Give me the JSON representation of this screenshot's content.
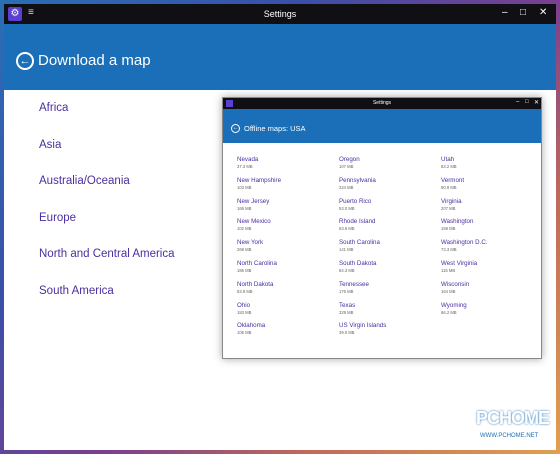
{
  "window": {
    "title": "Settings",
    "menu_icon": "hamburger-icon",
    "app_icon": "gear-icon",
    "controls": [
      "–",
      "□",
      "✕"
    ]
  },
  "header": {
    "title": "Download a map",
    "back_icon": "back-arrow-icon"
  },
  "regions": [
    "Africa",
    "Asia",
    "Australia/Oceania",
    "Europe",
    "North and Central America",
    "South America"
  ],
  "inner_window": {
    "title": "Settings",
    "header_title": "Offline maps: USA",
    "states": [
      {
        "name": "Nevada",
        "size": "37.3 MB"
      },
      {
        "name": "New Hampshire",
        "size": "103 MB"
      },
      {
        "name": "New Jersey",
        "size": "166 MB"
      },
      {
        "name": "New Mexico",
        "size": "102 MB"
      },
      {
        "name": "New York",
        "size": "268 MB"
      },
      {
        "name": "North Carolina",
        "size": "186 MB"
      },
      {
        "name": "North Dakota",
        "size": "83.9 MB"
      },
      {
        "name": "Ohio",
        "size": "183 MB"
      },
      {
        "name": "Oklahoma",
        "size": "106 MB"
      },
      {
        "name": "Oregon",
        "size": "107 MB"
      },
      {
        "name": "Pennsylvania",
        "size": "224 MB"
      },
      {
        "name": "Puerto Rico",
        "size": "53.0 MB"
      },
      {
        "name": "Rhode Island",
        "size": "63.6 MB"
      },
      {
        "name": "South Carolina",
        "size": "141 MB"
      },
      {
        "name": "South Dakota",
        "size": "84.3 MB"
      },
      {
        "name": "Tennessee",
        "size": "176 MB"
      },
      {
        "name": "Texas",
        "size": "329 MB"
      },
      {
        "name": "US Virgin Islands",
        "size": "39.0 MB"
      },
      {
        "name": "Utah",
        "size": "83.2 MB"
      },
      {
        "name": "Vermont",
        "size": "90.9 MB"
      },
      {
        "name": "Virginia",
        "size": "207 MB"
      },
      {
        "name": "Washington",
        "size": "159 MB"
      },
      {
        "name": "Washington D.C.",
        "size": "73.3 MB"
      },
      {
        "name": "West Virginia",
        "size": "115 MB"
      },
      {
        "name": "Wisconsin",
        "size": "164 MB"
      },
      {
        "name": "Wyoming",
        "size": "66.2 MB"
      }
    ]
  },
  "watermark": {
    "logo": "PCHOME",
    "url": "WWW.PCHOME.NET"
  },
  "colors": {
    "accent": "#1a6fb8",
    "link": "#4b2fa0",
    "titlebar": "#0f0f14"
  }
}
